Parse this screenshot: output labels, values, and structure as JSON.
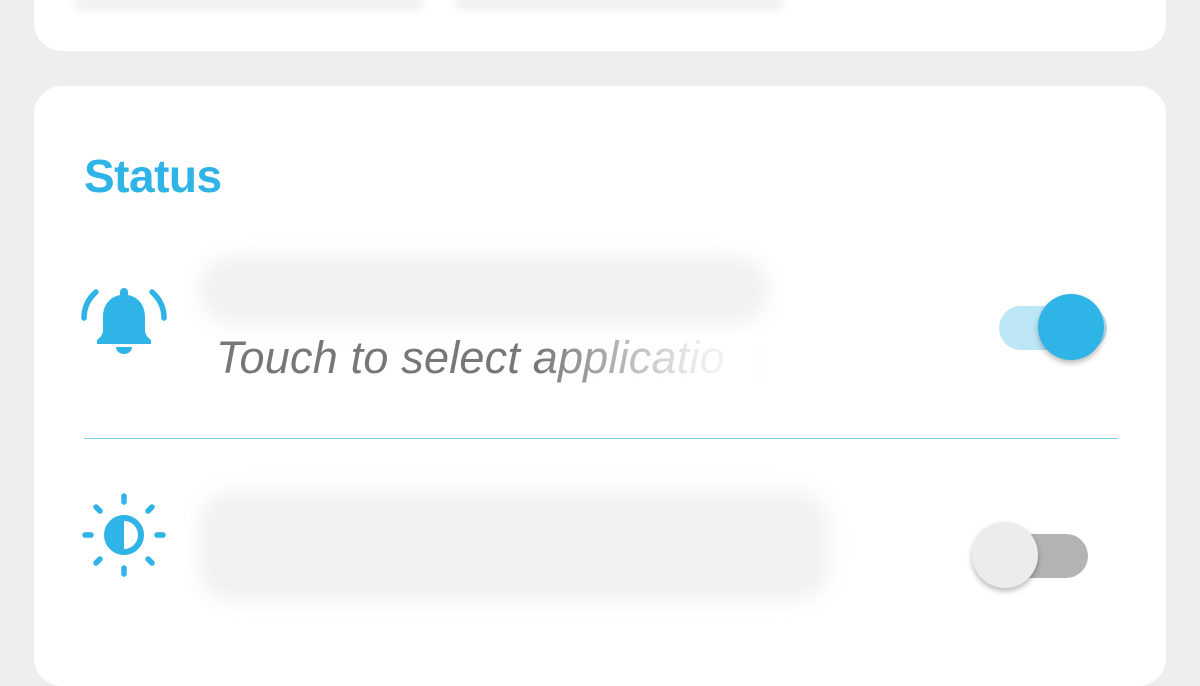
{
  "colors": {
    "accent": "#2eb4e6",
    "background": "#eeeeee",
    "card": "#ffffff",
    "toggle_on_track": "#bde6f7",
    "toggle_off_thumb": "#ececec",
    "toggle_off_track": "#b3b3b3",
    "subtitle_text": "#777777",
    "divider": "#7fd0ec"
  },
  "status_section": {
    "title": "Status",
    "rows": [
      {
        "icon": "bell-ring-icon",
        "subtitle": "Touch to select applicatio",
        "toggle_on": true
      },
      {
        "icon": "brightness-icon",
        "toggle_on": false
      }
    ]
  }
}
